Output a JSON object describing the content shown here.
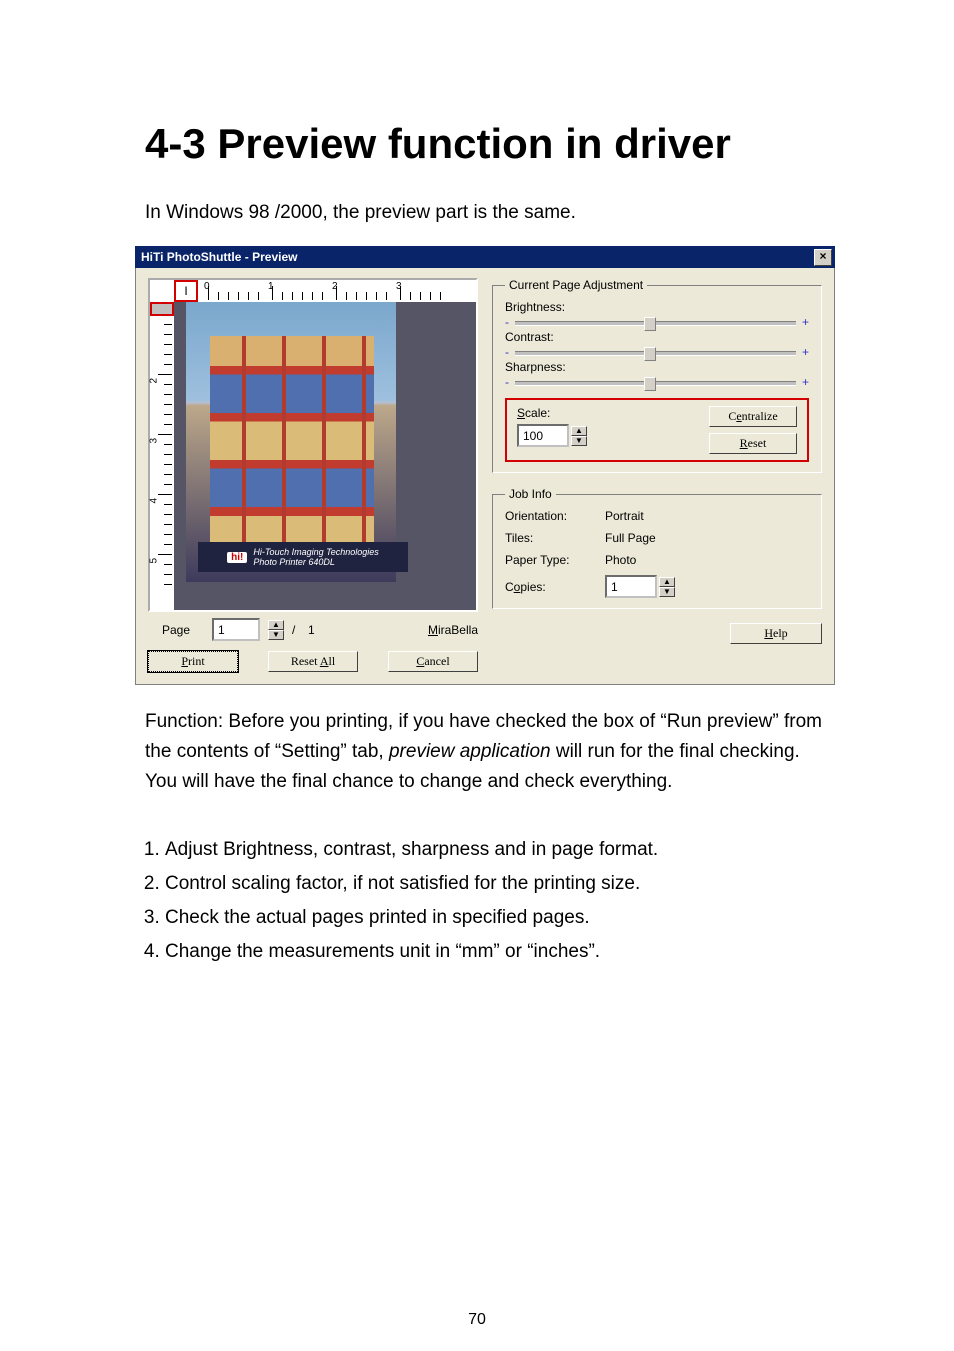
{
  "heading": "4-3  Preview function in driver",
  "intro": "In Windows 98 /2000, the preview part is the same.",
  "function_text": {
    "prefix": "Function:    Before you printing, if you have checked the box of “Run preview” from the contents of “Setting” tab, ",
    "italic": "preview application",
    "suffix": " will run for the final checking.    You will have the final chance to change and check everything."
  },
  "list": [
    "Adjust Brightness, contrast, sharpness and in page format.",
    "Control scaling factor, if not satisfied for the printing size.",
    "Check the actual pages printed in specified pages.",
    "Change the measurements unit in “mm” or “inches”."
  ],
  "page_number": "70",
  "dialog": {
    "title": "HiTi PhotoShuttle - Preview",
    "close": "×",
    "ruler_h": {
      "origin": "I",
      "majors": [
        "0",
        "1",
        "2",
        "3"
      ]
    },
    "ruler_v": {
      "majors": [
        "2",
        "3",
        "4",
        "5"
      ]
    },
    "photo_caption_logo": "hi!",
    "photo_caption_line1": "Hi-Touch Imaging Technologies",
    "photo_caption_line2": "Photo Printer 640DL",
    "page_label": "Page",
    "page_value": "1",
    "page_sep": "/",
    "page_total": "1",
    "mirabella": "MiraBella",
    "btn_print": "Print",
    "btn_resetall": "Reset All",
    "btn_cancel": "Cancel",
    "adjust": {
      "legend": "Current Page Adjustment",
      "brightness": "Brightness:",
      "contrast": "Contrast:",
      "sharpness": "Sharpness:",
      "minus": "-",
      "plus": "+",
      "scale_label": "Scale:",
      "scale_value": "100",
      "centralize": "Centralize",
      "reset": "Reset"
    },
    "job": {
      "legend": "Job Info",
      "orientation_l": "Orientation:",
      "orientation_v": "Portrait",
      "tiles_l": "Tiles:",
      "tiles_v": "Full Page",
      "paper_l": "Paper Type:",
      "paper_v": "Photo",
      "copies_l": "Copies:",
      "copies_v": "1"
    },
    "help": "Help"
  },
  "u": {
    "p": "P",
    "a": "A",
    "c": "C",
    "m": "M",
    "s": "S",
    "e": "e",
    "r": "R",
    "o": "o",
    "h": "H"
  }
}
